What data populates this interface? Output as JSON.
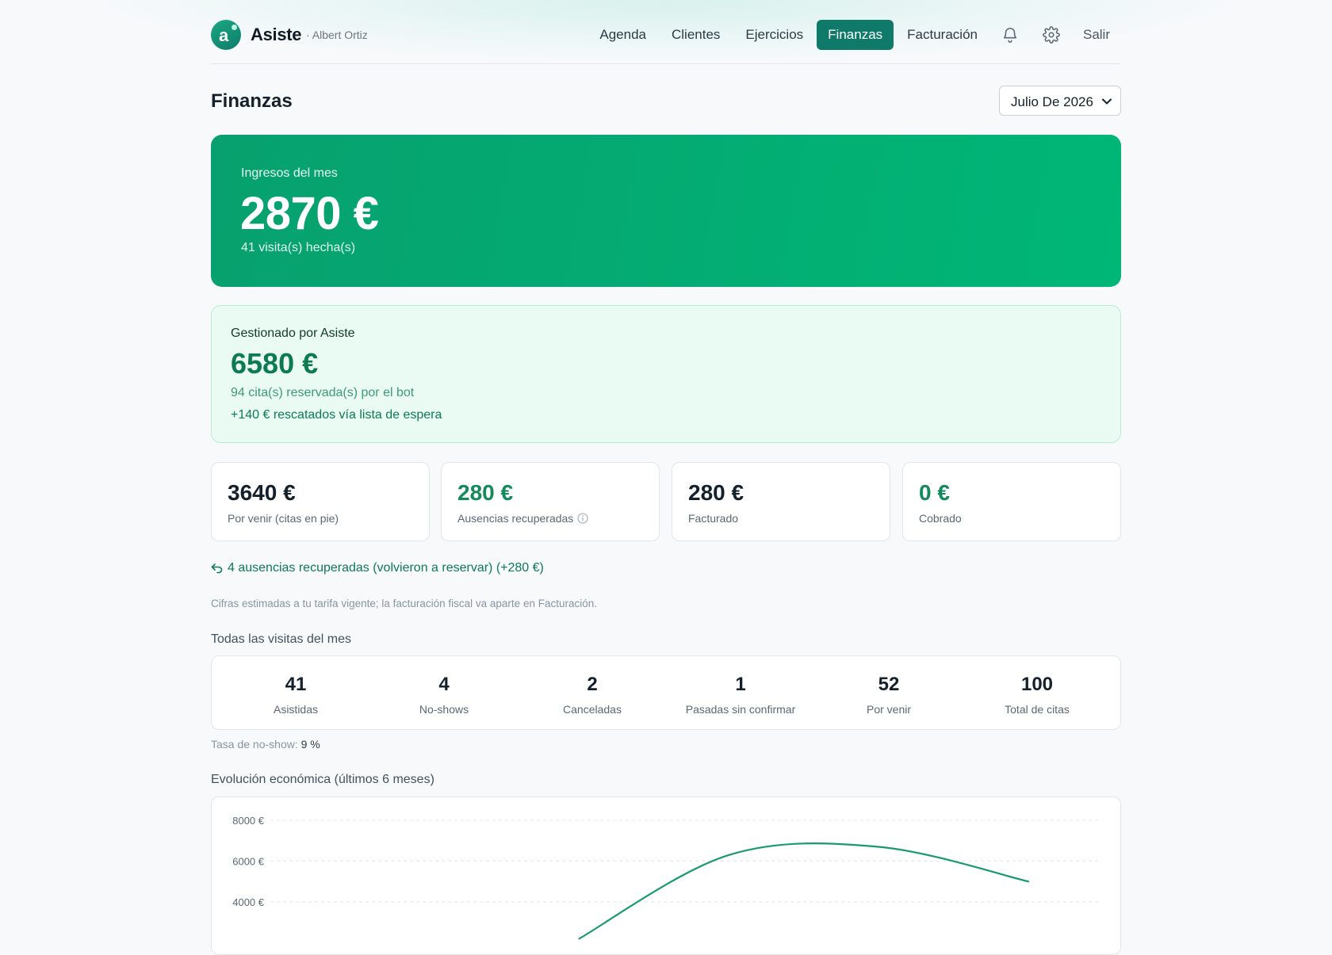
{
  "app": {
    "brand": "Asiste",
    "user": "· Albert Ortiz",
    "logo_letter": "a",
    "accent_color": "#0f7a6a"
  },
  "nav": {
    "items": [
      {
        "label": "Agenda"
      },
      {
        "label": "Clientes"
      },
      {
        "label": "Ejercicios"
      },
      {
        "label": "Finanzas",
        "active": true
      },
      {
        "label": "Facturación"
      }
    ],
    "icons": [
      "bell-icon",
      "gear-icon"
    ],
    "exit_label": "Salir"
  },
  "page": {
    "title": "Finanzas",
    "month_selected": "Julio De 2026"
  },
  "hero": {
    "label": "Ingresos del mes",
    "value": "2870 €",
    "sub": "41 visita(s) hecha(s)"
  },
  "managed": {
    "label": "Gestionado por Asiste",
    "value": "6580 €",
    "sub": "94 cita(s) reservada(s) por el bot",
    "rescue": "+140 € rescatados vía lista de espera"
  },
  "stats": [
    {
      "value": "3640 €",
      "label": "Por venir (citas en pie)"
    },
    {
      "value": "280 €",
      "label": "Ausencias recuperadas"
    },
    {
      "value": "280 €",
      "label": "Facturado"
    },
    {
      "value": "0 €",
      "label": "Cobrado"
    }
  ],
  "recovered_line": "4 ausencias recuperadas (volvieron a reservar) (+280 €)",
  "estimate_note": "Cifras estimadas a tu tarifa vigente; la facturación fiscal va aparte en Facturación.",
  "visits": {
    "title": "Todas las visitas del mes",
    "items": [
      {
        "value": "41",
        "label": "Asistidas"
      },
      {
        "value": "4",
        "label": "No-shows"
      },
      {
        "value": "2",
        "label": "Canceladas"
      },
      {
        "value": "1",
        "label": "Pasadas sin confirmar"
      },
      {
        "value": "52",
        "label": "Por venir"
      },
      {
        "value": "100",
        "label": "Total de citas"
      }
    ],
    "noshow_label": "Tasa de no-show:",
    "noshow_value": "9 %"
  },
  "chart": {
    "title": "Evolución económica (últimos 6 meses)"
  },
  "chart_data": {
    "type": "line",
    "title": "Evolución económica (últimos 6 meses)",
    "y_ticks": [
      "8000 €",
      "6000 €",
      "4000 €"
    ],
    "y_tick_values": [
      8000,
      6000,
      4000
    ],
    "grid": true,
    "series": [
      {
        "color": "#189a6c",
        "values": [
          null,
          null,
          2200,
          6300,
          6700,
          5000
        ]
      }
    ]
  }
}
